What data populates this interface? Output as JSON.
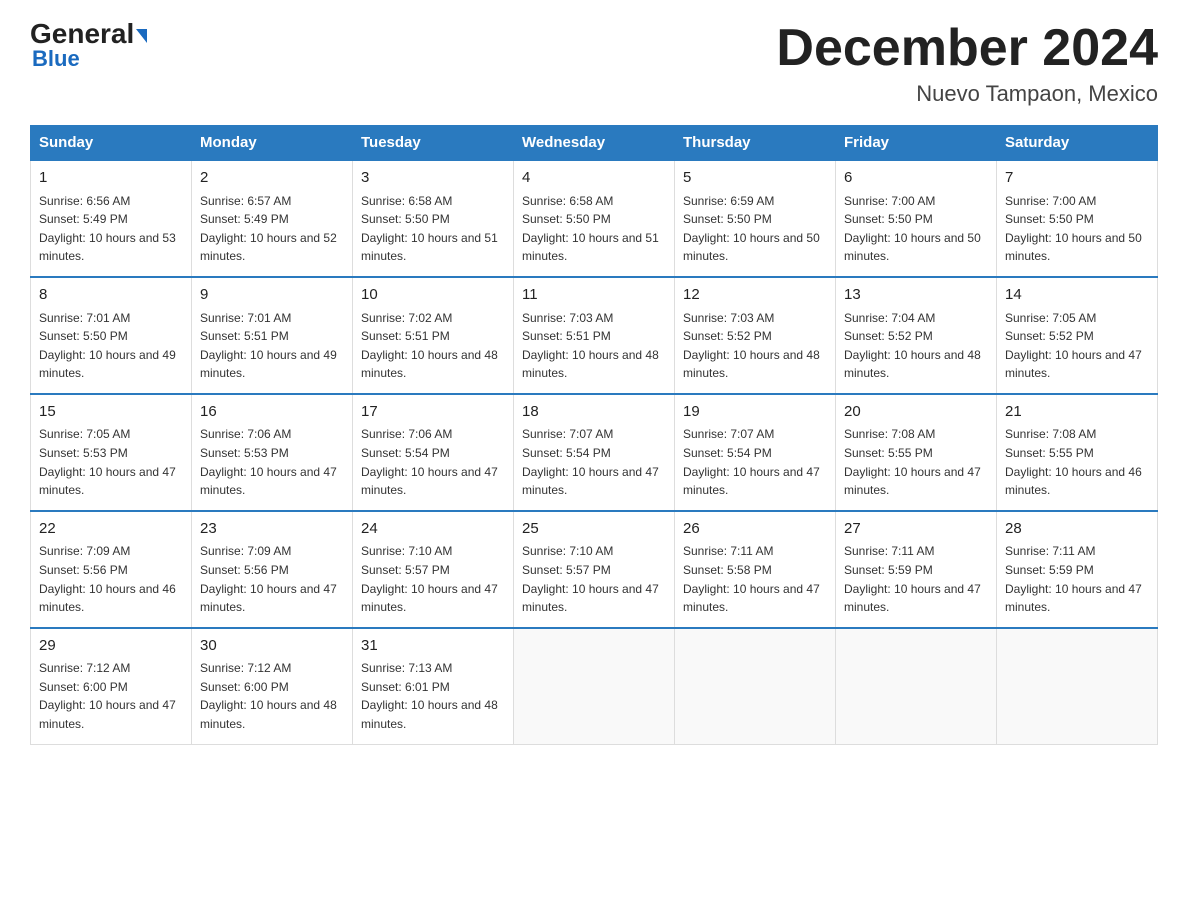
{
  "logo": {
    "general": "General",
    "blue": "Blue",
    "arrow": "▶"
  },
  "header": {
    "month": "December 2024",
    "location": "Nuevo Tampaon, Mexico"
  },
  "weekdays": [
    "Sunday",
    "Monday",
    "Tuesday",
    "Wednesday",
    "Thursday",
    "Friday",
    "Saturday"
  ],
  "weeks": [
    [
      {
        "day": "1",
        "sunrise": "6:56 AM",
        "sunset": "5:49 PM",
        "daylight": "10 hours and 53 minutes."
      },
      {
        "day": "2",
        "sunrise": "6:57 AM",
        "sunset": "5:49 PM",
        "daylight": "10 hours and 52 minutes."
      },
      {
        "day": "3",
        "sunrise": "6:58 AM",
        "sunset": "5:50 PM",
        "daylight": "10 hours and 51 minutes."
      },
      {
        "day": "4",
        "sunrise": "6:58 AM",
        "sunset": "5:50 PM",
        "daylight": "10 hours and 51 minutes."
      },
      {
        "day": "5",
        "sunrise": "6:59 AM",
        "sunset": "5:50 PM",
        "daylight": "10 hours and 50 minutes."
      },
      {
        "day": "6",
        "sunrise": "7:00 AM",
        "sunset": "5:50 PM",
        "daylight": "10 hours and 50 minutes."
      },
      {
        "day": "7",
        "sunrise": "7:00 AM",
        "sunset": "5:50 PM",
        "daylight": "10 hours and 50 minutes."
      }
    ],
    [
      {
        "day": "8",
        "sunrise": "7:01 AM",
        "sunset": "5:50 PM",
        "daylight": "10 hours and 49 minutes."
      },
      {
        "day": "9",
        "sunrise": "7:01 AM",
        "sunset": "5:51 PM",
        "daylight": "10 hours and 49 minutes."
      },
      {
        "day": "10",
        "sunrise": "7:02 AM",
        "sunset": "5:51 PM",
        "daylight": "10 hours and 48 minutes."
      },
      {
        "day": "11",
        "sunrise": "7:03 AM",
        "sunset": "5:51 PM",
        "daylight": "10 hours and 48 minutes."
      },
      {
        "day": "12",
        "sunrise": "7:03 AM",
        "sunset": "5:52 PM",
        "daylight": "10 hours and 48 minutes."
      },
      {
        "day": "13",
        "sunrise": "7:04 AM",
        "sunset": "5:52 PM",
        "daylight": "10 hours and 48 minutes."
      },
      {
        "day": "14",
        "sunrise": "7:05 AM",
        "sunset": "5:52 PM",
        "daylight": "10 hours and 47 minutes."
      }
    ],
    [
      {
        "day": "15",
        "sunrise": "7:05 AM",
        "sunset": "5:53 PM",
        "daylight": "10 hours and 47 minutes."
      },
      {
        "day": "16",
        "sunrise": "7:06 AM",
        "sunset": "5:53 PM",
        "daylight": "10 hours and 47 minutes."
      },
      {
        "day": "17",
        "sunrise": "7:06 AM",
        "sunset": "5:54 PM",
        "daylight": "10 hours and 47 minutes."
      },
      {
        "day": "18",
        "sunrise": "7:07 AM",
        "sunset": "5:54 PM",
        "daylight": "10 hours and 47 minutes."
      },
      {
        "day": "19",
        "sunrise": "7:07 AM",
        "sunset": "5:54 PM",
        "daylight": "10 hours and 47 minutes."
      },
      {
        "day": "20",
        "sunrise": "7:08 AM",
        "sunset": "5:55 PM",
        "daylight": "10 hours and 47 minutes."
      },
      {
        "day": "21",
        "sunrise": "7:08 AM",
        "sunset": "5:55 PM",
        "daylight": "10 hours and 46 minutes."
      }
    ],
    [
      {
        "day": "22",
        "sunrise": "7:09 AM",
        "sunset": "5:56 PM",
        "daylight": "10 hours and 46 minutes."
      },
      {
        "day": "23",
        "sunrise": "7:09 AM",
        "sunset": "5:56 PM",
        "daylight": "10 hours and 47 minutes."
      },
      {
        "day": "24",
        "sunrise": "7:10 AM",
        "sunset": "5:57 PM",
        "daylight": "10 hours and 47 minutes."
      },
      {
        "day": "25",
        "sunrise": "7:10 AM",
        "sunset": "5:57 PM",
        "daylight": "10 hours and 47 minutes."
      },
      {
        "day": "26",
        "sunrise": "7:11 AM",
        "sunset": "5:58 PM",
        "daylight": "10 hours and 47 minutes."
      },
      {
        "day": "27",
        "sunrise": "7:11 AM",
        "sunset": "5:59 PM",
        "daylight": "10 hours and 47 minutes."
      },
      {
        "day": "28",
        "sunrise": "7:11 AM",
        "sunset": "5:59 PM",
        "daylight": "10 hours and 47 minutes."
      }
    ],
    [
      {
        "day": "29",
        "sunrise": "7:12 AM",
        "sunset": "6:00 PM",
        "daylight": "10 hours and 47 minutes."
      },
      {
        "day": "30",
        "sunrise": "7:12 AM",
        "sunset": "6:00 PM",
        "daylight": "10 hours and 48 minutes."
      },
      {
        "day": "31",
        "sunrise": "7:13 AM",
        "sunset": "6:01 PM",
        "daylight": "10 hours and 48 minutes."
      },
      null,
      null,
      null,
      null
    ]
  ]
}
